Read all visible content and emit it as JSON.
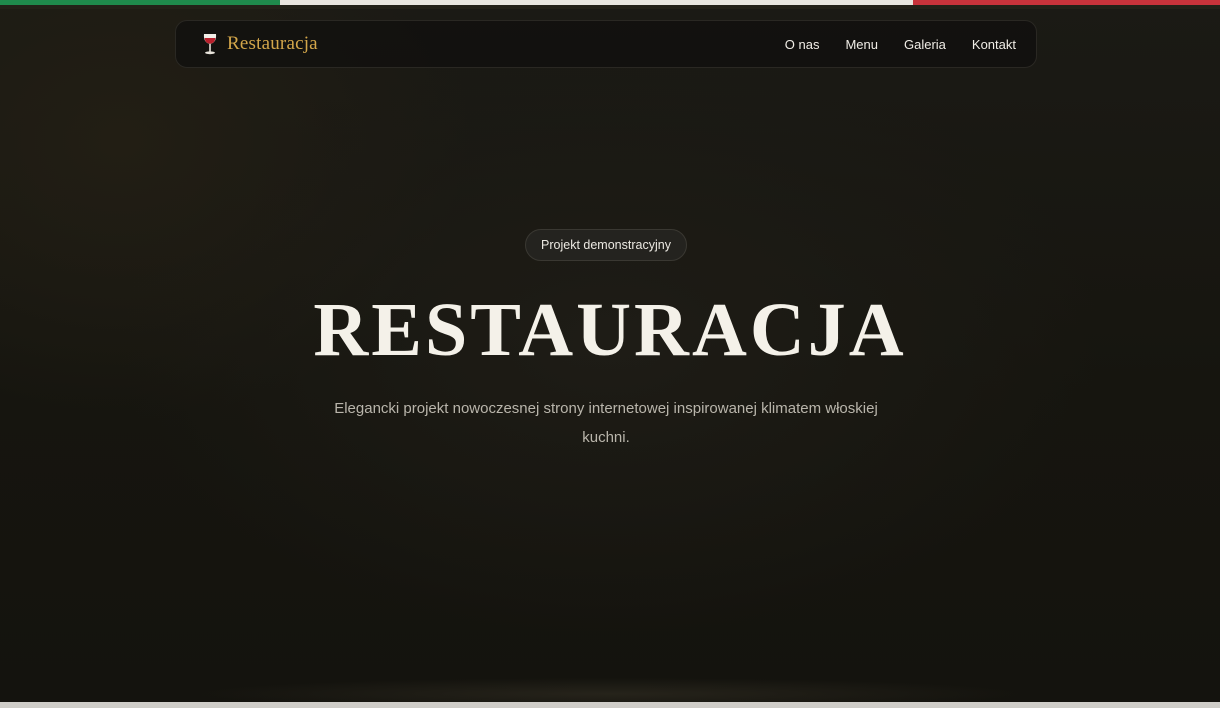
{
  "flag": {
    "colors": [
      "#1f8a4c",
      "#e9e6df",
      "#c8333b"
    ]
  },
  "navbar": {
    "brand_icon": "wine-glass-icon",
    "brand_name": "Restauracja",
    "links": [
      {
        "label": "O nas"
      },
      {
        "label": "Menu"
      },
      {
        "label": "Galeria"
      },
      {
        "label": "Kontakt"
      }
    ]
  },
  "hero": {
    "badge": "Projekt demonstracyjny",
    "title": "RESTAURACJA",
    "subtitle": "Elegancki projekt nowoczesnej strony internetowej inspirowanej klimatem włoskiej kuchni."
  },
  "colors": {
    "accent": "#d3a64a",
    "background": "#16140f",
    "title": "#f4f1e9"
  }
}
